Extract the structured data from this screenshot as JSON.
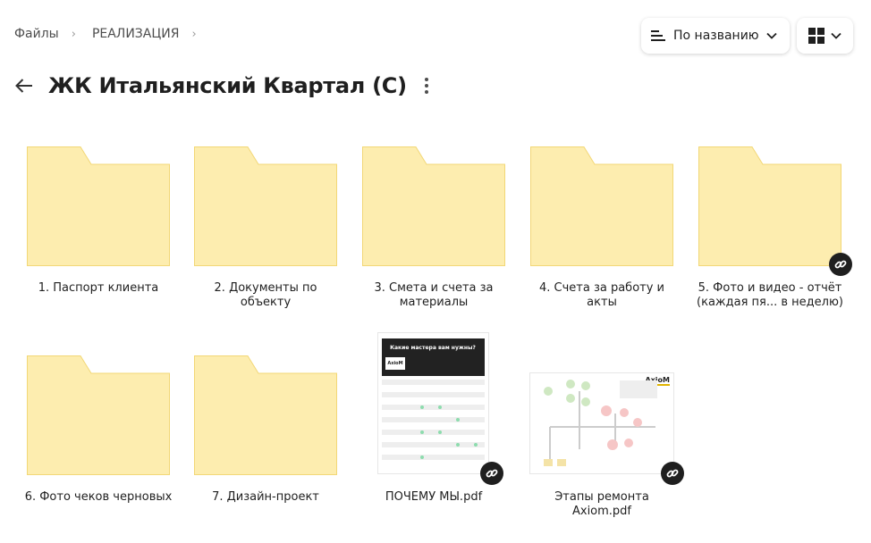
{
  "breadcrumb": {
    "items": [
      "Файлы",
      "РЕАЛИЗАЦИЯ"
    ],
    "separator": "›"
  },
  "toolbar": {
    "sort_label": "По названию",
    "sort_icon": "sort-lines-icon",
    "view_icon": "grid-view-icon"
  },
  "page": {
    "title": "ЖК Итальянский Квартал (С)",
    "back_icon": "arrow-left-icon",
    "more_icon": "more-vertical-icon"
  },
  "colors": {
    "folder_fill": "#fdedaf",
    "folder_stroke": "#f2d776",
    "badge": "#1f1f1f"
  },
  "items": [
    {
      "type": "folder",
      "name": "1. Паспорт клиента",
      "shared": false
    },
    {
      "type": "folder",
      "name": "2. Документы по объекту",
      "shared": false
    },
    {
      "type": "folder",
      "name": "3. Смета и счета за материалы",
      "shared": false
    },
    {
      "type": "folder",
      "name": "4. Счета за работу и акты",
      "shared": false
    },
    {
      "type": "folder",
      "name": "5. Фото и видео - отчёт (каждая пя... в неделю)",
      "shared": true
    },
    {
      "type": "folder",
      "name": "6. Фото чеков черновых",
      "shared": false
    },
    {
      "type": "folder",
      "name": "7. Дизайн-проект",
      "shared": false
    },
    {
      "type": "pdf",
      "name": "ПОЧЕМУ МЫ.pdf",
      "shared": true,
      "preview": {
        "heading": "Какие мастера вам нужны?",
        "logo": "AxioM"
      }
    },
    {
      "type": "pdf",
      "name": "Этапы ремонта Axiom.pdf",
      "shared": true,
      "preview": {
        "logo": "AxioM"
      }
    }
  ]
}
